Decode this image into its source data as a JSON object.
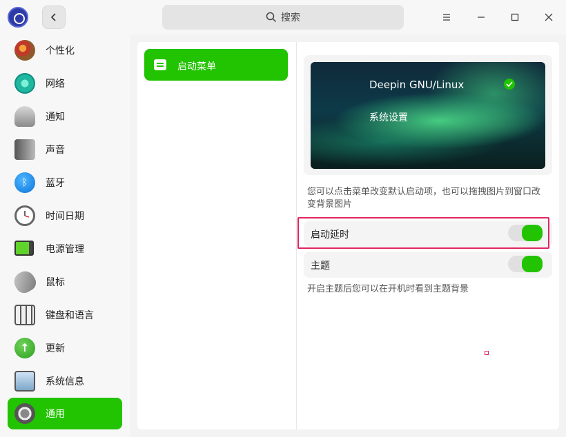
{
  "titlebar": {
    "back_icon": "chevron-left-icon",
    "search_placeholder": "搜索",
    "window_controls": [
      "menu-icon",
      "minimize-icon",
      "maximize-icon",
      "close-icon"
    ]
  },
  "sidebar": {
    "items": [
      {
        "label": "个性化",
        "icon": "palette-icon",
        "active": false
      },
      {
        "label": "网络",
        "icon": "network-icon",
        "active": false
      },
      {
        "label": "通知",
        "icon": "bell-icon",
        "active": false
      },
      {
        "label": "声音",
        "icon": "speaker-icon",
        "active": false
      },
      {
        "label": "蓝牙",
        "icon": "bluetooth-icon",
        "active": false
      },
      {
        "label": "时间日期",
        "icon": "clock-icon",
        "active": false
      },
      {
        "label": "电源管理",
        "icon": "battery-icon",
        "active": false
      },
      {
        "label": "鼠标",
        "icon": "mouse-icon",
        "active": false
      },
      {
        "label": "键盘和语言",
        "icon": "keyboard-icon",
        "active": false
      },
      {
        "label": "更新",
        "icon": "update-icon",
        "active": false
      },
      {
        "label": "系统信息",
        "icon": "system-info-icon",
        "active": false
      },
      {
        "label": "通用",
        "icon": "gear-icon",
        "active": true
      }
    ]
  },
  "middle": {
    "items": [
      {
        "label": "启动菜单",
        "icon": "menu-doc-icon",
        "active": true
      }
    ]
  },
  "content": {
    "preview": {
      "entry_default": "Deepin GNU/Linux",
      "entry_second": "系统设置"
    },
    "preview_hint": "您可以点击菜单改变默认启动项，也可以拖拽图片到窗口改变背景图片",
    "boot_delay": {
      "label": "启动延时",
      "enabled": true
    },
    "theme": {
      "label": "主题",
      "enabled": true
    },
    "theme_hint": "开启主题后您可以在开机时看到主题背景"
  },
  "colors": {
    "accent": "#22c301",
    "highlight": "#e0245e"
  }
}
